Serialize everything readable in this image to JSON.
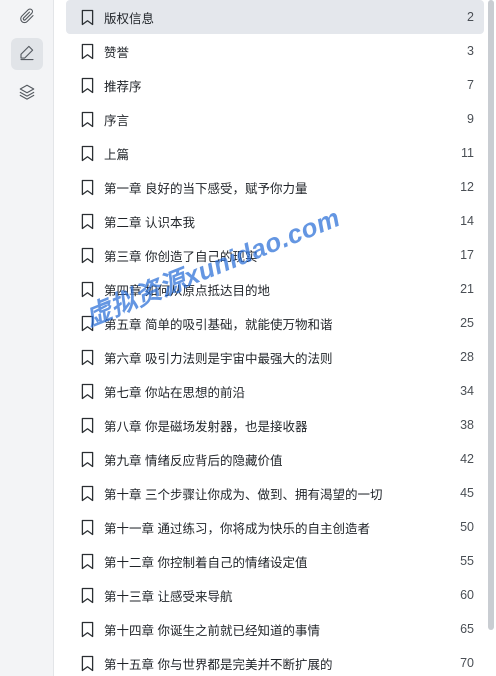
{
  "sidebar": {
    "tools": [
      {
        "name": "paperclip-icon",
        "active": false
      },
      {
        "name": "edit-icon",
        "active": true
      },
      {
        "name": "layers-icon",
        "active": false
      }
    ]
  },
  "toc": {
    "items": [
      {
        "title": "版权信息",
        "page": "2"
      },
      {
        "title": "赞誉",
        "page": "3"
      },
      {
        "title": "推荐序",
        "page": "7"
      },
      {
        "title": "序言",
        "page": "9"
      },
      {
        "title": "上篇",
        "page": "11"
      },
      {
        "title": "第一章 良好的当下感受，赋予你力量",
        "page": "12"
      },
      {
        "title": "第二章 认识本我",
        "page": "14"
      },
      {
        "title": "第三章 你创造了自己的现实",
        "page": "17"
      },
      {
        "title": "第四章 如何从原点抵达目的地",
        "page": "21"
      },
      {
        "title": "第五章 简单的吸引基础，就能使万物和谐",
        "page": "25"
      },
      {
        "title": "第六章 吸引力法则是宇宙中最强大的法则",
        "page": "28"
      },
      {
        "title": "第七章 你站在思想的前沿",
        "page": "34"
      },
      {
        "title": "第八章 你是磁场发射器，也是接收器",
        "page": "38"
      },
      {
        "title": "第九章 情绪反应背后的隐藏价值",
        "page": "42"
      },
      {
        "title": "第十章 三个步骤让你成为、做到、拥有渴望的一切",
        "page": "45"
      },
      {
        "title": "第十一章 通过练习，你将成为快乐的自主创造者",
        "page": "50"
      },
      {
        "title": "第十二章 你控制着自己的情绪设定值",
        "page": "55"
      },
      {
        "title": "第十三章 让感受来导航",
        "page": "60"
      },
      {
        "title": "第十四章 你诞生之前就已经知道的事情",
        "page": "65"
      },
      {
        "title": "第十五章 你与世界都是完美并不断扩展的",
        "page": "70"
      }
    ]
  },
  "watermark": "虚拟资源xunidao.com",
  "colors": {
    "selected_bg": "#e4e7ec",
    "rail_bg": "#f3f4f6",
    "watermark": "#286ed7"
  }
}
